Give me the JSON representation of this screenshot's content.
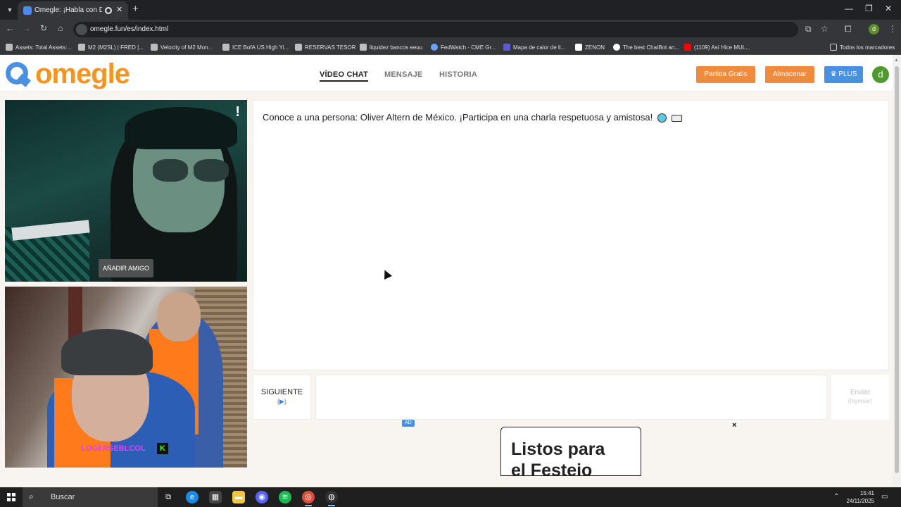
{
  "browser": {
    "tab_title": "Omegle: ¡Habla con Desco...",
    "url": "omegle.fun/es/index.html",
    "bookmarks": [
      "Assets: Total Assets:...",
      "M2 (M2SL) | FRED |...",
      "Velocity of M2 Mon...",
      "ICE BofA US High Yi...",
      "RESERVAS TESORO",
      "liquidez bancos eeuu",
      "FedWatch - CME Gr...",
      "Mapa de calor de li...",
      "ZENON",
      "The best ChatBot an...",
      "(1109) Así Hice MUL...",
      "Todos los marcadores"
    ],
    "profile_initial": "d"
  },
  "site": {
    "logo_text": "omegle",
    "nav": {
      "video_chat": "VÍDEO CHAT",
      "message": "MENSAJE",
      "history": "HISTORIA"
    },
    "buttons": {
      "free_game": "Partida Gratis",
      "store": "Almacenar",
      "plus": "PLUS"
    },
    "user_initial": "d",
    "colors": {
      "orange": "#f7931e",
      "blue": "#4a90e2",
      "green": "#4e9a2f"
    }
  },
  "video": {
    "add_friend": "AÑADIR AMIGO",
    "report_icon": "!",
    "stream_watermark": "LOGERSEBLCOL"
  },
  "chat": {
    "intro": "Conoce a una persona: Oliver Altern de México. ¡Participa en una charla respetuosa y amistosa!",
    "next_label": "SIGUIENTE",
    "next_hint": "(▶)",
    "send_label": "Enviar",
    "send_hint": "(Ingresar)"
  },
  "ad": {
    "badge": "AD",
    "line1": "Listos para",
    "line2": "el Festejo",
    "close": "×"
  },
  "taskbar": {
    "search": "Buscar",
    "time": "15:41",
    "date": "24/11/2025"
  }
}
